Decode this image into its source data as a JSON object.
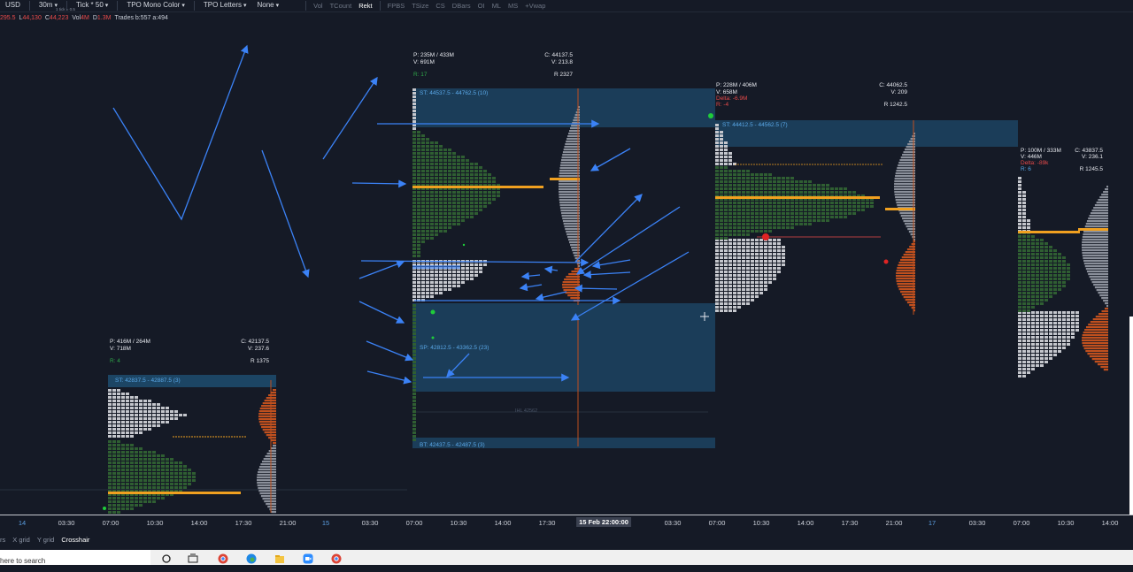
{
  "toolbar": {
    "symbol": "USD",
    "timeframe": "30m",
    "tick": "Tick * 50",
    "tick_sub": "1 tick = 0.5",
    "color_mode": "TPO Mono Color",
    "letters": "TPO Letters",
    "none_label": "None",
    "indicators": [
      "Vol",
      "TCount",
      "Rekt",
      "FPBS",
      "TSize",
      "CS",
      "DBars",
      "OI",
      "ML",
      "MS",
      "+Vwap"
    ],
    "active_indicator": "Rekt"
  },
  "infobar": {
    "o_value": "295.5",
    "l_label": "L",
    "l_value": "44,130",
    "c_label": "C",
    "c_value": "44,223",
    "vol_label": "Vol",
    "vol_value": "4M",
    "d_label": "D",
    "d_value": "1.3M",
    "trades": "Trades b:557 a:494"
  },
  "profiles": [
    {
      "p": "P: 416M / 264M",
      "v": "V: 718M",
      "r": "R: 4",
      "c": "C: 42137.5",
      "v2": "V: 237.6",
      "r2": "R 1375",
      "st": "ST: 42837.5 - 42887.5 (3)"
    },
    {
      "p": "P: 235M / 433M",
      "v": "V: 691M",
      "r": "R: 17",
      "c": "C: 44137.5",
      "v2": "V: 213.8",
      "r2": "R 2327",
      "st": "ST: 44537.5 - 44762.5 (10)",
      "sp": "SP: 42812.5 - 43362.5 (23)",
      "bt": "BT: 42437.5 - 42487.5 (3)",
      "ihl": "IHL 42562"
    },
    {
      "p": "P: 228M / 406M",
      "v": "V: 658M",
      "delta": "Delta: -6.9M",
      "r": "R: -4",
      "c": "C: 44062.5",
      "v2": "V: 209",
      "r2": "R 1242.5",
      "st": "ST: 44412.5 - 44562.5 (7)"
    },
    {
      "p": "P: 100M / 333M",
      "v": "V: 446M",
      "delta": "Delta: -89k",
      "r": "R: 6",
      "c": "C: 43837.5",
      "v2": "V: 236.1",
      "r2": "R 1245.5"
    }
  ],
  "xaxis": [
    {
      "label": "14",
      "kind": "day"
    },
    {
      "label": "03:30"
    },
    {
      "label": "07:00"
    },
    {
      "label": "10:30"
    },
    {
      "label": "14:00"
    },
    {
      "label": "17:30"
    },
    {
      "label": "21:00"
    },
    {
      "label": "15",
      "kind": "day"
    },
    {
      "label": "03:30"
    },
    {
      "label": "07:00"
    },
    {
      "label": "10:30"
    },
    {
      "label": "14:00"
    },
    {
      "label": "17:30"
    },
    {
      "label": "15 Feb 22:00:00",
      "kind": "hl"
    },
    {
      "label": "03:30"
    },
    {
      "label": "07:00"
    },
    {
      "label": "10:30"
    },
    {
      "label": "14:00"
    },
    {
      "label": "17:30"
    },
    {
      "label": "21:00"
    },
    {
      "label": "17",
      "kind": "day"
    },
    {
      "label": "03:30"
    },
    {
      "label": "07:00"
    },
    {
      "label": "10:30"
    },
    {
      "label": "14:00"
    }
  ],
  "bottombar": {
    "items": [
      "rs",
      "X grid",
      "Y grid",
      "Crosshair"
    ],
    "active": "Crosshair"
  },
  "taskbar": {
    "search_placeholder": "here to search"
  },
  "colors": {
    "background": "#151a26",
    "tpo_green": "#2f5e32",
    "tpo_gray": "#c4c6cc",
    "poc_orange": "#f0a020",
    "value_area_blue": "#1d4a6b",
    "arrow_blue": "#3b82f6",
    "volume_orange": "#c0501e"
  }
}
